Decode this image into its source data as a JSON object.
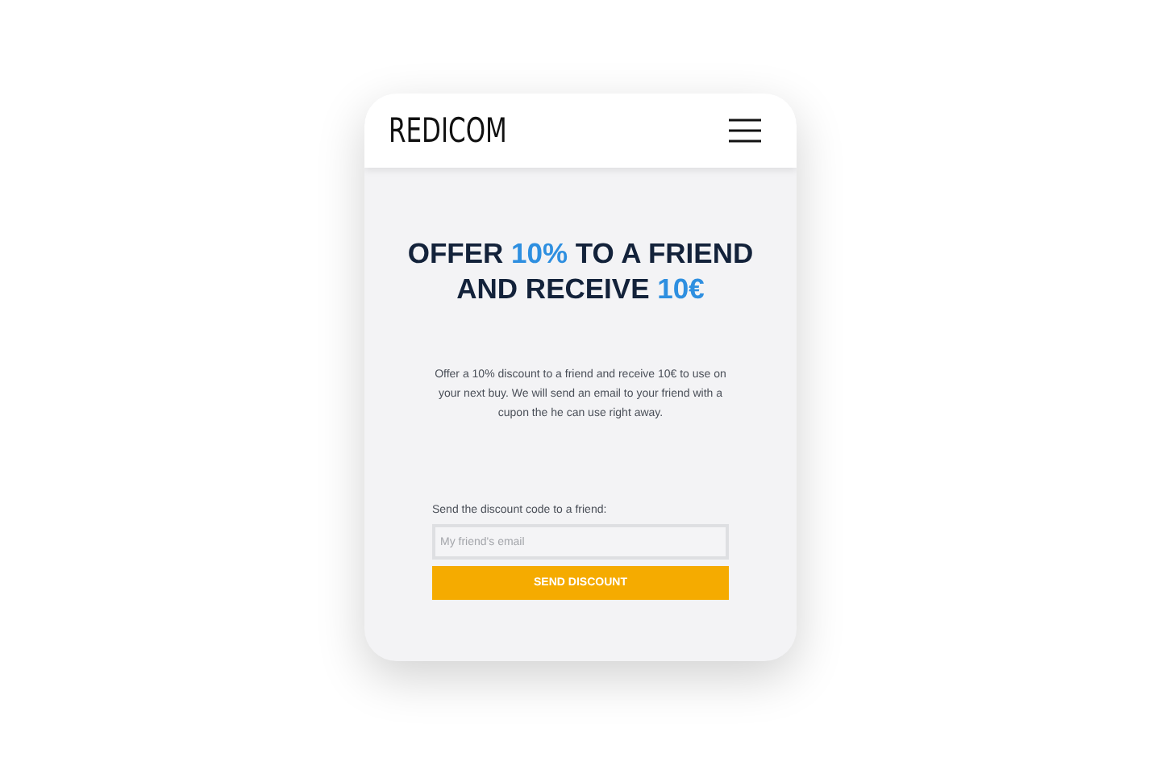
{
  "header": {
    "logo": "REDICOM"
  },
  "headline": [
    {
      "text": "OFFER ",
      "highlight": false
    },
    {
      "text": "10%",
      "highlight": true
    },
    {
      "text": " TO A FRIEND AND RECEIVE ",
      "highlight": false
    },
    {
      "text": "10€",
      "highlight": true
    }
  ],
  "description": "Offer a 10% discount to a friend and receive 10€ to use on your next buy. We will send an email to your friend with a cupon the he can use right away.",
  "form": {
    "label": "Send the discount code to a friend:",
    "email": {
      "placeholder": "My friend's email"
    },
    "button": "SEND DISCOUNT"
  }
}
